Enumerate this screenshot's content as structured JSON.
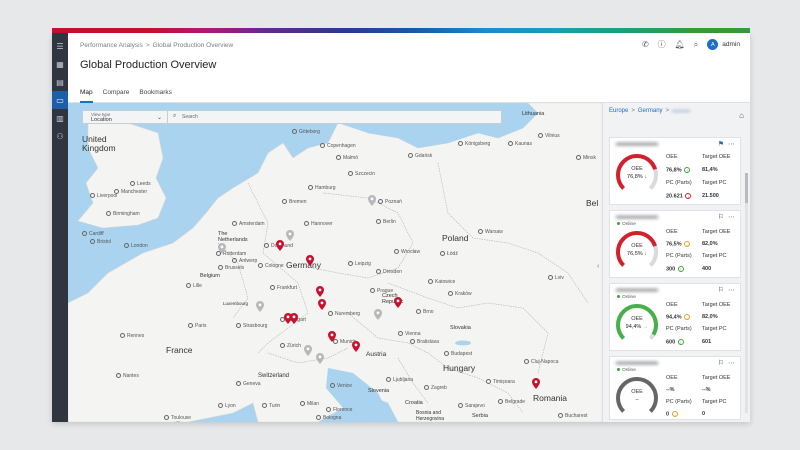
{
  "header": {
    "breadcrumb": [
      "Performance Analysis",
      "Global Production Overview"
    ],
    "title": "Global Production Overview",
    "user": "admin",
    "avatar_initial": "A"
  },
  "tabs": [
    {
      "label": "Map",
      "active": true
    },
    {
      "label": "Compare",
      "active": false
    },
    {
      "label": "Bookmarks",
      "active": false
    }
  ],
  "map_controls": {
    "view_type_label": "View type",
    "view_type_value": "Location",
    "search_placeholder": "Search"
  },
  "map_labels": {
    "countries": [
      {
        "text": "United\nKingdom"
      },
      {
        "text": "Germany"
      },
      {
        "text": "Poland"
      },
      {
        "text": "France"
      },
      {
        "text": "Austria"
      },
      {
        "text": "Hungary"
      },
      {
        "text": "Romania"
      },
      {
        "text": "Czech\nRepublic"
      },
      {
        "text": "Slovakia"
      },
      {
        "text": "Switzerland"
      },
      {
        "text": "Croatia"
      },
      {
        "text": "Slovenia"
      },
      {
        "text": "Bosnia and\nHerzegovina"
      },
      {
        "text": "Serbia"
      },
      {
        "text": "Lithuania"
      },
      {
        "text": "Belgium"
      },
      {
        "text": "The\nNetherlands"
      },
      {
        "text": "Luxembourg"
      },
      {
        "text": "Bel"
      }
    ],
    "cities": [
      "London",
      "Birmingham",
      "Manchester",
      "Leeds",
      "Liverpool",
      "Cardiff",
      "Bristol",
      "Paris",
      "Lille",
      "Amsterdam",
      "Rotterdam",
      "Brussels",
      "Antwerp",
      "Hamburg",
      "Bremen",
      "Berlin",
      "Hannover",
      "Dortmund",
      "Cologne",
      "Frankfurt",
      "Stuttgart",
      "Munich",
      "Nuremberg",
      "Leipzig",
      "Dresden",
      "Prague",
      "Brno",
      "Vienna",
      "Budapest",
      "Bratislava",
      "Warsaw",
      "Gdańsk",
      "Poznań",
      "Wrocław",
      "Kraków",
      "Łódź",
      "Katowice",
      "Szczecin",
      "Zürich",
      "Geneva",
      "Milan",
      "Turin",
      "Venice",
      "Zagreb",
      "Ljubljana",
      "Belgrade",
      "Sarajevo",
      "Bucharest",
      "Cluj-Napoca",
      "Timișoara",
      "Lviv",
      "Minsk",
      "Vilnius",
      "Kaunas",
      "Königsberg",
      "Lyon",
      "Strasbourg",
      "Copenhagen",
      "Malmö",
      "Göteborg",
      "Bologna",
      "Florence",
      "Nantes",
      "Rennes",
      "Toulouse"
    ]
  },
  "right_panel": {
    "breadcrumb": [
      "Europe",
      "Germany"
    ],
    "cards": [
      {
        "status": "",
        "bookmarked": true,
        "gauge_label": "OEE",
        "gauge_value": "76,8%",
        "gauge_fraction": 0.768,
        "gauge_color": "#d3212c",
        "gauge_trend": "↓",
        "oee_label": "OEE",
        "oee_value": "76,8%",
        "oee_ind": "↑",
        "oee_ind_color": "green",
        "target_oee_label": "Target OEE",
        "target_oee_value": "81,4%",
        "pc_label": "PC (Parts)",
        "pc_value": "20.621",
        "pc_ind": "↓",
        "pc_ind_color": "red",
        "target_pc_label": "Target PC",
        "target_pc_value": "21.500"
      },
      {
        "status": "Online",
        "bookmarked": false,
        "gauge_label": "OEE",
        "gauge_value": "76,5%",
        "gauge_fraction": 0.765,
        "gauge_color": "#d3212c",
        "gauge_trend": "↓",
        "oee_label": "OEE",
        "oee_value": "76,5%",
        "oee_ind": "→",
        "oee_ind_color": "orange",
        "target_oee_label": "Target OEE",
        "target_oee_value": "82,0%",
        "pc_label": "PC (Parts)",
        "pc_value": "300",
        "pc_ind": "↑",
        "pc_ind_color": "green",
        "target_pc_label": "Target PC",
        "target_pc_value": "400"
      },
      {
        "status": "Online",
        "bookmarked": false,
        "gauge_label": "OEE",
        "gauge_value": "94,4%",
        "gauge_fraction": 0.944,
        "gauge_color": "#46b04a",
        "gauge_trend": "→",
        "oee_label": "OEE",
        "oee_value": "94,4%",
        "oee_ind": "→",
        "oee_ind_color": "orange",
        "target_oee_label": "Target OEE",
        "target_oee_value": "82,0%",
        "pc_label": "PC (Parts)",
        "pc_value": "600",
        "pc_ind": "↑",
        "pc_ind_color": "green",
        "target_pc_label": "Target PC",
        "target_pc_value": "601"
      },
      {
        "status": "Online",
        "bookmarked": false,
        "gauge_label": "OEE",
        "gauge_value": "–",
        "gauge_fraction": 0.0,
        "gauge_color": "#666666",
        "gauge_trend": "",
        "oee_label": "OEE",
        "oee_value": "--%",
        "oee_ind": "",
        "oee_ind_color": "",
        "target_oee_label": "Target OEE",
        "target_oee_value": "--%",
        "pc_label": "PC (Parts)",
        "pc_value": "0",
        "pc_ind": "→",
        "pc_ind_color": "orange",
        "target_pc_label": "Target PC",
        "target_pc_value": "0"
      }
    ]
  },
  "colors": {
    "accent": "#1c6fc2",
    "sidebar": "#2f3640",
    "pin": "#c8102e",
    "water": "#a9d3ef",
    "land": "#f4f4f2"
  }
}
